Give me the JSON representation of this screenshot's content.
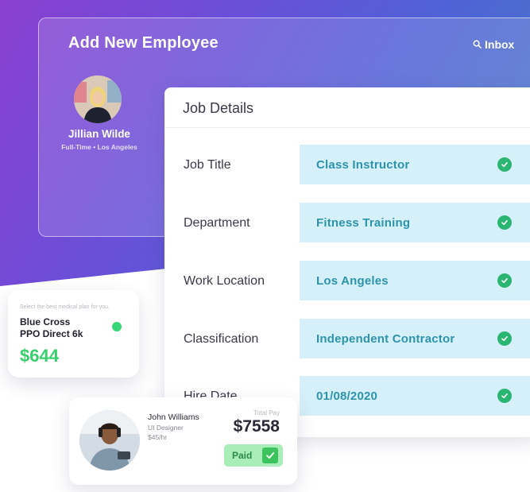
{
  "header": {
    "title": "Add New Employee",
    "inbox_label": "Inbox",
    "inbox_icon": "search-icon"
  },
  "profile": {
    "name": "Jillian Wilde",
    "meta": "Full-Time  •  Los Angeles"
  },
  "job_details": {
    "title": "Job Details",
    "fields": [
      {
        "label": "Job Title",
        "value": "Class Instructor",
        "status_icon": "check-circle-icon"
      },
      {
        "label": "Department",
        "value": "Fitness Training",
        "status_icon": "check-circle-icon"
      },
      {
        "label": "Work Location",
        "value": "Los Angeles",
        "status_icon": "check-circle-icon"
      },
      {
        "label": "Classification",
        "value": "Independent Contractor",
        "status_icon": "check-circle-icon"
      },
      {
        "label": "Hire Date",
        "value": "01/08/2020",
        "status_icon": "check-circle-icon"
      }
    ]
  },
  "insurance": {
    "hint": "Select the best medical plan for you.",
    "plan_line1": "Blue Cross",
    "plan_line2": "PPO Direct 6k",
    "price": "$644"
  },
  "payroll": {
    "name": "John Williams",
    "role": "UI Designer",
    "rate": "$45/hr",
    "total_label": "Total Pay",
    "total": "$7558",
    "status": "Paid"
  },
  "colors": {
    "gradient_start": "#8a3fd0",
    "gradient_end": "#5a86c4",
    "field_bg": "#d6f0f9",
    "field_text": "#2d93ad",
    "check_green": "#2bb573",
    "price_green": "#38cf6c",
    "paid_bg": "#a9eeb9"
  }
}
